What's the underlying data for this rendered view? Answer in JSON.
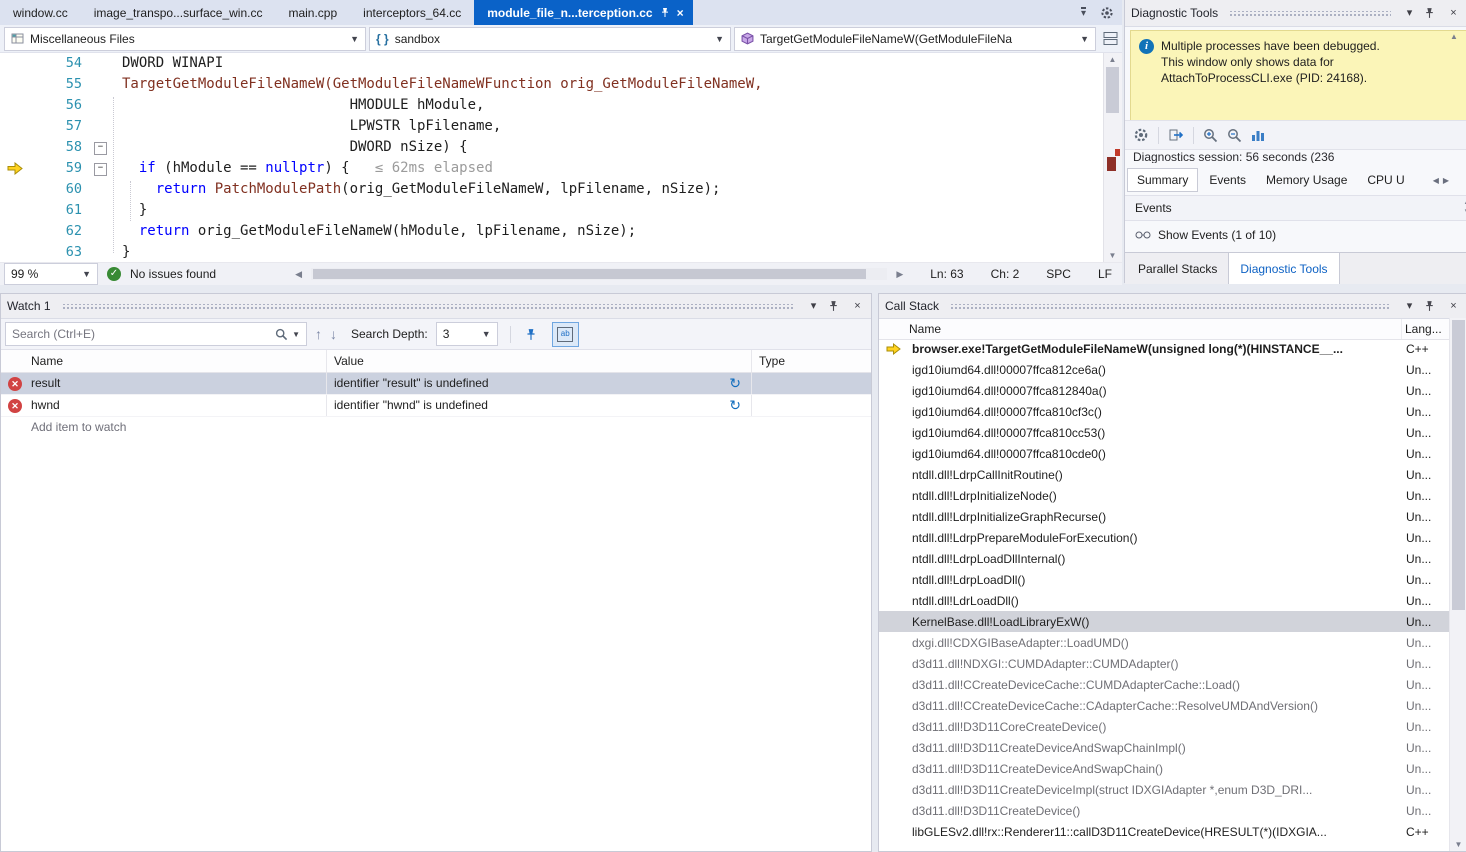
{
  "tab_bar": {
    "tabs": [
      {
        "label": "window.cc",
        "active": false
      },
      {
        "label": "image_transpo...surface_win.cc",
        "active": false
      },
      {
        "label": "main.cpp",
        "active": false
      },
      {
        "label": "interceptors_64.cc",
        "active": false
      },
      {
        "label": "module_file_n...terception.cc",
        "active": true
      }
    ]
  },
  "navbar": {
    "project": "Miscellaneous Files",
    "scope_braces": "{ }",
    "scope": "sandbox",
    "member": "TargetGetModuleFileNameW(GetModuleFileNa"
  },
  "editor": {
    "lines": [
      {
        "num": "54",
        "segs": [
          [
            "DWORD WINAPI",
            "t"
          ]
        ]
      },
      {
        "num": "55",
        "segs": [
          [
            "TargetGetModuleFileNameW(GetModuleFileNameWFunction orig_GetModuleFileNameW,",
            "f"
          ]
        ]
      },
      {
        "num": "56",
        "segs": [
          [
            "                           HMODULE hModule,",
            "t"
          ]
        ]
      },
      {
        "num": "57",
        "segs": [
          [
            "                           LPWSTR lpFilename,",
            "t"
          ]
        ]
      },
      {
        "num": "58",
        "fold": true,
        "segs": [
          [
            "                           DWORD nSize) {",
            "t"
          ]
        ]
      },
      {
        "num": "59",
        "fold": true,
        "arrow": true,
        "segs": [
          [
            "  ",
            "t"
          ],
          [
            "if",
            "k"
          ],
          [
            " (hModule == ",
            "t"
          ],
          [
            "nullptr",
            "k"
          ],
          [
            ") {",
            "t"
          ],
          [
            "   ≤ 62ms elapsed",
            "p"
          ]
        ]
      },
      {
        "num": "60",
        "segs": [
          [
            "    ",
            "t"
          ],
          [
            "return",
            "k"
          ],
          [
            " ",
            "t"
          ],
          [
            "PatchModulePath",
            "f"
          ],
          [
            "(orig_GetModuleFileNameW, lpFilename, nSize);",
            "t"
          ]
        ]
      },
      {
        "num": "61",
        "segs": [
          [
            "  }",
            "t"
          ]
        ]
      },
      {
        "num": "62",
        "segs": [
          [
            "  ",
            "t"
          ],
          [
            "return",
            "k"
          ],
          [
            " orig_GetModuleFileNameW(hModule, lpFilename, nSize);",
            "t"
          ]
        ]
      },
      {
        "num": "63",
        "segs": [
          [
            "}",
            "t"
          ]
        ]
      }
    ]
  },
  "status": {
    "zoom": "99 %",
    "issues": "No issues found",
    "ln": "Ln: 63",
    "ch": "Ch: 2",
    "enc": "SPC",
    "eol": "LF"
  },
  "watch": {
    "title": "Watch 1",
    "search_placeholder": "Search (Ctrl+E)",
    "depth_label": "Search Depth:",
    "depth_value": "3",
    "columns": [
      "Name",
      "Value",
      "Type"
    ],
    "rows": [
      {
        "name": "result",
        "value": "identifier \"result\" is undefined",
        "type": "",
        "selected": true
      },
      {
        "name": "hwnd",
        "value": "identifier \"hwnd\" is undefined",
        "type": "",
        "selected": false
      }
    ],
    "add_row": "Add item to watch"
  },
  "diagnostics": {
    "title": "Diagnostic Tools",
    "notice": "Multiple processes have been debugged. This window only shows data for AttachToProcessCLI.exe (PID: 24168).",
    "session": "Diagnostics session: 56 seconds (236",
    "tabs": [
      {
        "label": "Summary",
        "active": true
      },
      {
        "label": "Events",
        "active": false
      },
      {
        "label": "Memory Usage",
        "active": false
      },
      {
        "label": "CPU U",
        "active": false
      }
    ],
    "events_header": "Events",
    "show_events": "Show Events (1 of 10)",
    "dock_tabs": [
      {
        "label": "Parallel Stacks",
        "active": false
      },
      {
        "label": "Diagnostic Tools",
        "active": true
      }
    ]
  },
  "callstack": {
    "title": "Call Stack",
    "columns": [
      "Name",
      "Lang..."
    ],
    "frames": [
      {
        "name": "browser.exe!TargetGetModuleFileNameW(unsigned long(*)(HINSTANCE__...",
        "lang": "C++",
        "current": true
      },
      {
        "name": "igd10iumd64.dll!00007ffca812ce6a()",
        "lang": "Un..."
      },
      {
        "name": "igd10iumd64.dll!00007ffca812840a()",
        "lang": "Un..."
      },
      {
        "name": "igd10iumd64.dll!00007ffca810cf3c()",
        "lang": "Un..."
      },
      {
        "name": "igd10iumd64.dll!00007ffca810cc53()",
        "lang": "Un..."
      },
      {
        "name": "igd10iumd64.dll!00007ffca810cde0()",
        "lang": "Un..."
      },
      {
        "name": "ntdll.dll!LdrpCallInitRoutine()",
        "lang": "Un..."
      },
      {
        "name": "ntdll.dll!LdrpInitializeNode()",
        "lang": "Un..."
      },
      {
        "name": "ntdll.dll!LdrpInitializeGraphRecurse()",
        "lang": "Un..."
      },
      {
        "name": "ntdll.dll!LdrpPrepareModuleForExecution()",
        "lang": "Un..."
      },
      {
        "name": "ntdll.dll!LdrpLoadDllInternal()",
        "lang": "Un..."
      },
      {
        "name": "ntdll.dll!LdrpLoadDll()",
        "lang": "Un..."
      },
      {
        "name": "ntdll.dll!LdrLoadDll()",
        "lang": "Un..."
      },
      {
        "name": "KernelBase.dll!LoadLibraryExW()",
        "lang": "Un...",
        "selected": true
      },
      {
        "name": "dxgi.dll!CDXGIBaseAdapter::LoadUMD()",
        "lang": "Un...",
        "style": "dim"
      },
      {
        "name": "d3d11.dll!NDXGI::CUMDAdapter::CUMDAdapter()",
        "lang": "Un...",
        "style": "dim"
      },
      {
        "name": "d3d11.dll!CCreateDeviceCache::CUMDAdapterCache::Load()",
        "lang": "Un...",
        "style": "dim"
      },
      {
        "name": "d3d11.dll!CCreateDeviceCache::CAdapterCache::ResolveUMDAndVersion()",
        "lang": "Un...",
        "style": "dim"
      },
      {
        "name": "d3d11.dll!D3D11CoreCreateDevice()",
        "lang": "Un...",
        "style": "dim"
      },
      {
        "name": "d3d11.dll!D3D11CreateDeviceAndSwapChainImpl()",
        "lang": "Un...",
        "style": "dim"
      },
      {
        "name": "d3d11.dll!D3D11CreateDeviceAndSwapChain()",
        "lang": "Un...",
        "style": "dim"
      },
      {
        "name": "d3d11.dll!D3D11CreateDeviceImpl(struct IDXGIAdapter *,enum D3D_DRI...",
        "lang": "Un...",
        "style": "dim"
      },
      {
        "name": "d3d11.dll!D3D11CreateDevice()",
        "lang": "Un...",
        "style": "dim"
      },
      {
        "name": "libGLESv2.dll!rx::Renderer11::callD3D11CreateDevice(HRESULT(*)(IDXGIA...",
        "lang": "C++"
      }
    ]
  }
}
